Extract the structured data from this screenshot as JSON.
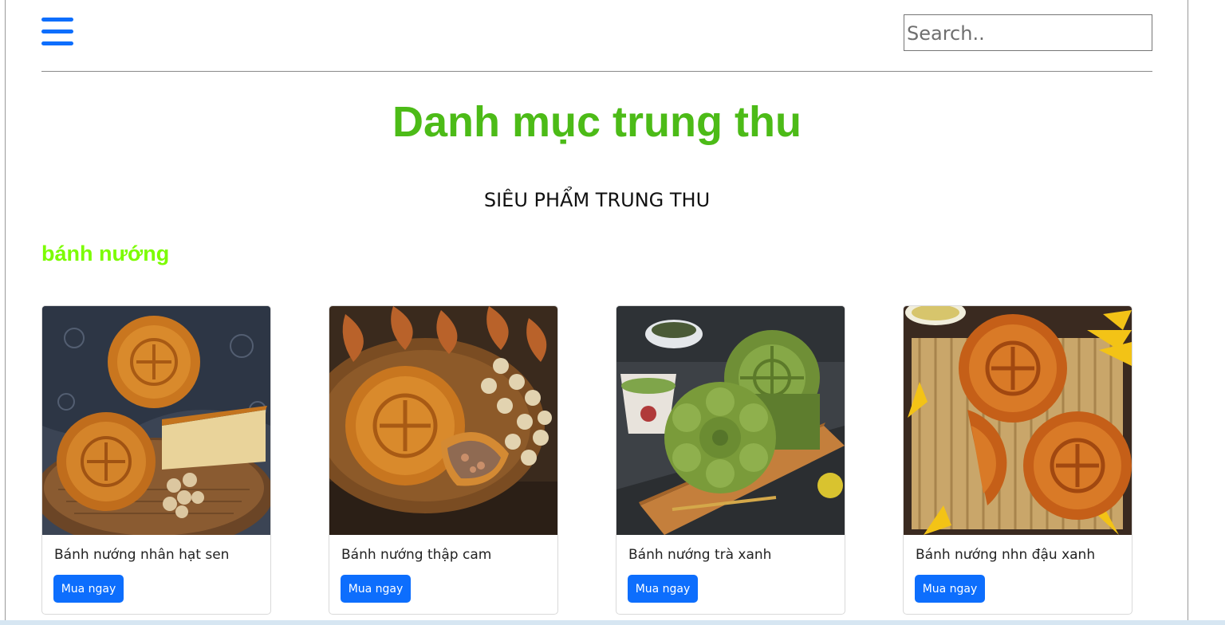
{
  "header": {
    "search_placeholder": "Search.."
  },
  "page_title": "Danh mục trung thu",
  "subtitle": "SIÊU PHẨM TRUNG THU",
  "section_title": "bánh nướng",
  "products": [
    {
      "name": "Bánh nướng nhân hạt sen",
      "button_label": "Mua ngay"
    },
    {
      "name": "Bánh nướng thập cam",
      "button_label": "Mua ngay"
    },
    {
      "name": "Bánh nướng trà xanh",
      "button_label": "Mua ngay"
    },
    {
      "name": "Bánh nướng nhn đậu xanh",
      "button_label": "Mua ngay"
    }
  ],
  "colors": {
    "accent": "#0d6efd",
    "title_green": "#4cbb17",
    "section_green": "#7cfc00"
  }
}
